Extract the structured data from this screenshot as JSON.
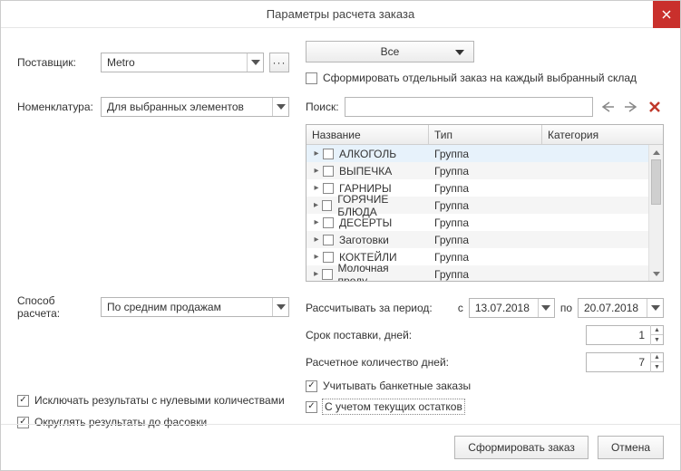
{
  "title": "Параметры расчета заказа",
  "labels": {
    "supplier": "Поставщик:",
    "nomenclature": "Номенклатура:",
    "method": "Способ расчета:",
    "search": "Поиск:",
    "period": "Рассчитывать за период:",
    "period_from": "с",
    "period_to": "по",
    "delivery_days": "Срок поставки, дней:",
    "calc_days": "Расчетное количество дней:"
  },
  "values": {
    "supplier": "Metro",
    "nomenclature": "Для выбранных элементов",
    "method": "По средним продажам",
    "warehouse_filter": "Все",
    "date_from": "13.07.2018",
    "date_to": "20.07.2018",
    "delivery_days": "1",
    "calc_days": "7"
  },
  "checkboxes": {
    "separate_order": {
      "label": "Сформировать отдельный заказ на каждый выбранный склад",
      "checked": false
    },
    "banquet": {
      "label": "Учитывать банкетные заказы",
      "checked": true
    },
    "remains": {
      "label": "С учетом текущих остатков",
      "checked": true
    },
    "exclude_zero": {
      "label": "Исключать результаты с нулевыми количествами",
      "checked": true
    },
    "round_pack": {
      "label": "Округлять результаты до фасовки",
      "checked": true
    }
  },
  "grid": {
    "columns": {
      "name": "Название",
      "type": "Тип",
      "category": "Категория"
    },
    "rows": [
      {
        "name": "АЛКОГОЛЬ",
        "type": "Группа",
        "category": ""
      },
      {
        "name": "ВЫПЕЧКА",
        "type": "Группа",
        "category": ""
      },
      {
        "name": "ГАРНИРЫ",
        "type": "Группа",
        "category": ""
      },
      {
        "name": "ГОРЯЧИЕ БЛЮДА",
        "type": "Группа",
        "category": ""
      },
      {
        "name": "ДЕСЕРТЫ",
        "type": "Группа",
        "category": ""
      },
      {
        "name": "Заготовки",
        "type": "Группа",
        "category": ""
      },
      {
        "name": "КОКТЕЙЛИ",
        "type": "Группа",
        "category": ""
      },
      {
        "name": "Молочная проду...",
        "type": "Группа",
        "category": ""
      }
    ]
  },
  "buttons": {
    "submit": "Сформировать заказ",
    "cancel": "Отмена"
  }
}
